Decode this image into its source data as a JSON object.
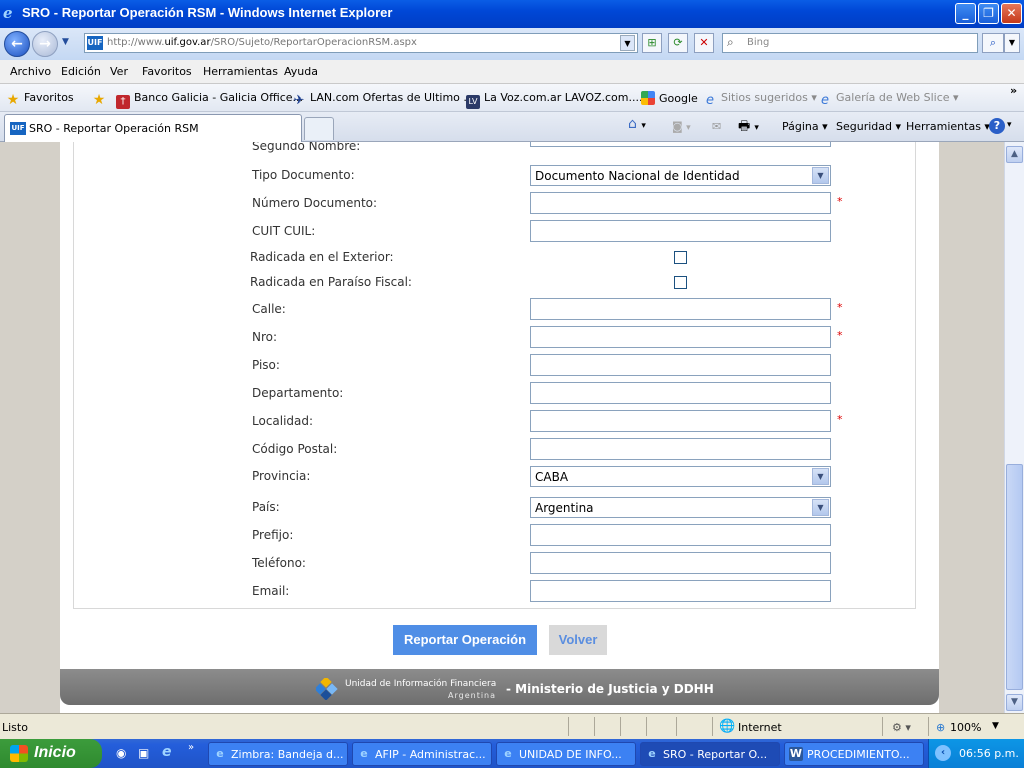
{
  "window": {
    "title": "SRO - Reportar Operación RSM - Windows Internet Explorer"
  },
  "address": {
    "url_prefix": "http://www.",
    "url_domain": "uif.gov.ar",
    "url_path": "/SRO/Sujeto/ReportarOperacionRSM.aspx",
    "site_badge": "UIF",
    "search_placeholder": "Bing"
  },
  "menu": [
    "Archivo",
    "Edición",
    "Ver",
    "Favoritos",
    "Herramientas",
    "Ayuda"
  ],
  "favorites": {
    "label": "Favoritos",
    "items": [
      "Banco Galicia - Galicia Office...",
      "LAN.com Ofertas de Ultimo ...",
      "La Voz.com.ar  LAVOZ.com....",
      "Google",
      "Sitios sugeridos",
      "Galería de Web Slice"
    ],
    "more": "»"
  },
  "tab": {
    "title": "SRO - Reportar Operación RSM"
  },
  "commands": {
    "page": "Página",
    "security": "Seguridad",
    "tools": "Herramientas"
  },
  "form": {
    "segundo_nombre": "Segundo Nombre:",
    "tipo_documento": "Tipo Documento:",
    "tipo_documento_value": "Documento Nacional de Identidad",
    "numero_documento": "Número Documento:",
    "cuit_cuil": "CUIT CUIL:",
    "radicada_exterior": "Radicada en el Exterior:",
    "radicada_paraiso": "Radicada en Paraíso Fiscal:",
    "calle": "Calle:",
    "nro": "Nro:",
    "piso": "Piso:",
    "departamento": "Departamento:",
    "localidad": "Localidad:",
    "codigo_postal": "Código Postal:",
    "provincia": "Provincia:",
    "provincia_value": "CABA",
    "pais": "País:",
    "pais_value": "Argentina",
    "prefijo": "Prefijo:",
    "telefono": "Teléfono:",
    "email": "Email:",
    "required_mark": "*"
  },
  "buttons": {
    "submit": "Reportar Operación",
    "back": "Volver"
  },
  "footer": {
    "org_line1": "Unidad de Información Financiera",
    "org_line2": "Argentina",
    "ministry": "- Ministerio de Justicia y DDHH"
  },
  "status": {
    "text": "Listo",
    "zone": "Internet",
    "zoom": "100%"
  },
  "taskbar": {
    "start": "Inicio",
    "tasks": [
      "Zimbra: Bandeja d...",
      "AFIP - Administrac...",
      "UNIDAD DE INFO...",
      "SRO - Reportar O...",
      "PROCEDIMIENTO..."
    ],
    "clock": "06:56 p.m."
  },
  "colors": {
    "accent": "#4f8ee6",
    "required": "#dd0000",
    "titlebar": "#0047d6"
  }
}
